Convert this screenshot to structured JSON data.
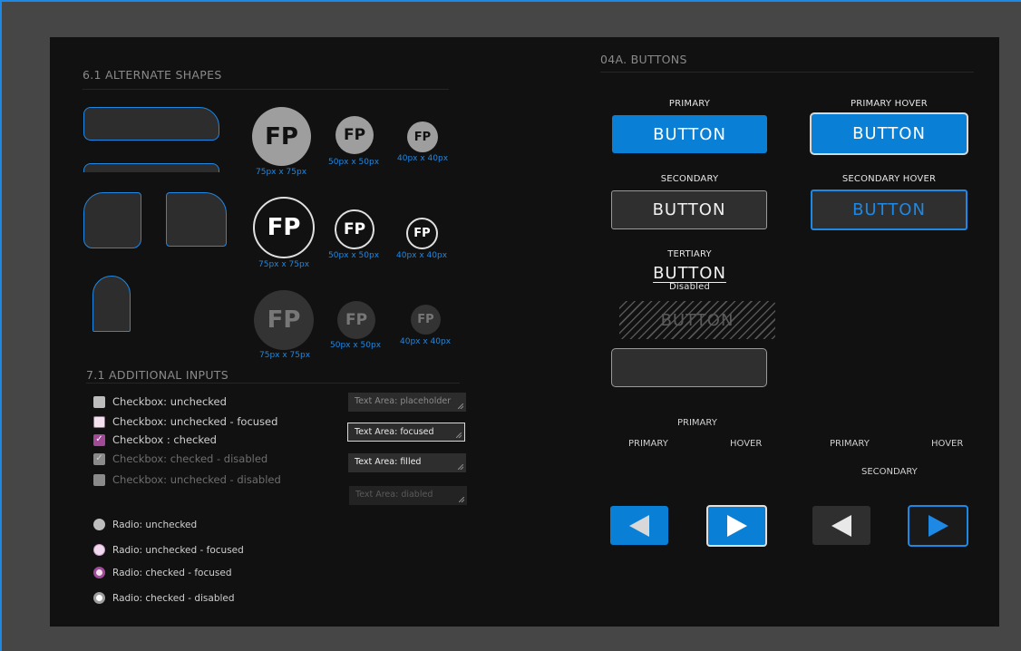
{
  "shapes": {
    "title": "6.1 ALTERNATE SHAPES",
    "avatar_initials": "FP",
    "sizes": {
      "large": "75px x 75px",
      "medium": "50px x 50px",
      "small": "40px x 40px"
    }
  },
  "inputs": {
    "title": "7.1  ADDITIONAL INPUTS",
    "checkboxes": [
      "Checkbox: unchecked",
      "Checkbox: unchecked - focused",
      "Checkbox : checked",
      "Checkbox: checked - disabled",
      "Checkbox: unchecked - disabled"
    ],
    "radios": [
      "Radio: unchecked",
      "Radio: unchecked - focused",
      "Radio: checked - focused",
      "Radio: checked - disabled"
    ],
    "textareas": [
      "Text Area: placeholder",
      "Text Area: focused",
      "Text Area: filled",
      "Text Area:  diabled"
    ]
  },
  "buttons": {
    "title": "04A. BUTTONS",
    "labels": {
      "primary": "PRIMARY",
      "primary_hover": "PRIMARY HOVER",
      "secondary": "SECONDARY",
      "secondary_hover": "SECONDARY HOVER",
      "tertiary": "TERTIARY",
      "disabled": "Disabled"
    },
    "button_text": "BUTTON",
    "arrow_labels": {
      "primary_group": "PRIMARY",
      "primary": "PRIMARY",
      "hover": "HOVER",
      "secondary_primary": "PRIMARY",
      "secondary_hover": "HOVER",
      "secondary_group": "SECONDARY"
    }
  },
  "colors": {
    "accent": "#1e88e5",
    "button_primary": "#0a7fd6",
    "checkbox_checked": "#a04a98",
    "board": "#111111",
    "page": "#464646"
  }
}
